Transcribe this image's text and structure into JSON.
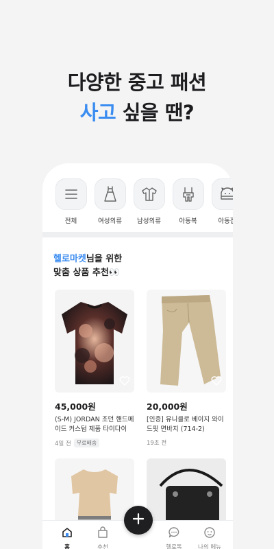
{
  "headline": {
    "line1": "다양한 중고 패션",
    "line2_accent": "사고",
    "line2_rest": " 싶을 땐?"
  },
  "colors": {
    "accent": "#3b8cf0",
    "background": "#f4f4f5",
    "fab": "#1f1f21"
  },
  "categories": [
    {
      "label": "전체",
      "icon": "menu-icon"
    },
    {
      "label": "여성의류",
      "icon": "dress-icon"
    },
    {
      "label": "남성의류",
      "icon": "shirt-icon"
    },
    {
      "label": "아동복",
      "icon": "overalls-icon"
    },
    {
      "label": "아동잡",
      "icon": "baby-hat-icon"
    }
  ],
  "recommend": {
    "brand": "헬로마켓",
    "line1_rest": "님을 위한",
    "line2": "맞춤 상품 추천👀"
  },
  "products": [
    {
      "price": "45,000원",
      "title": "(S-M) JORDAN 조던 핸드메이드 커스텀 제품 타이다이 ...",
      "time": "4일 전",
      "badge": "무료배송",
      "image": "tie-dye-tshirt"
    },
    {
      "price": "20,000원",
      "title": "[인증] 유니클로 베이지 와이드핏 면바지 (714-2)",
      "time": "19초 전",
      "badge": "",
      "image": "beige-pants"
    }
  ],
  "tabbar": {
    "tabs": [
      {
        "label": "홈",
        "icon": "home-icon",
        "active": true
      },
      {
        "label": "추천",
        "icon": "bag-icon",
        "active": false
      },
      {
        "label": "헬로톡",
        "icon": "chat-icon",
        "active": false
      },
      {
        "label": "나의 메뉴",
        "icon": "profile-icon",
        "active": false
      }
    ],
    "fab_icon": "plus-icon"
  }
}
